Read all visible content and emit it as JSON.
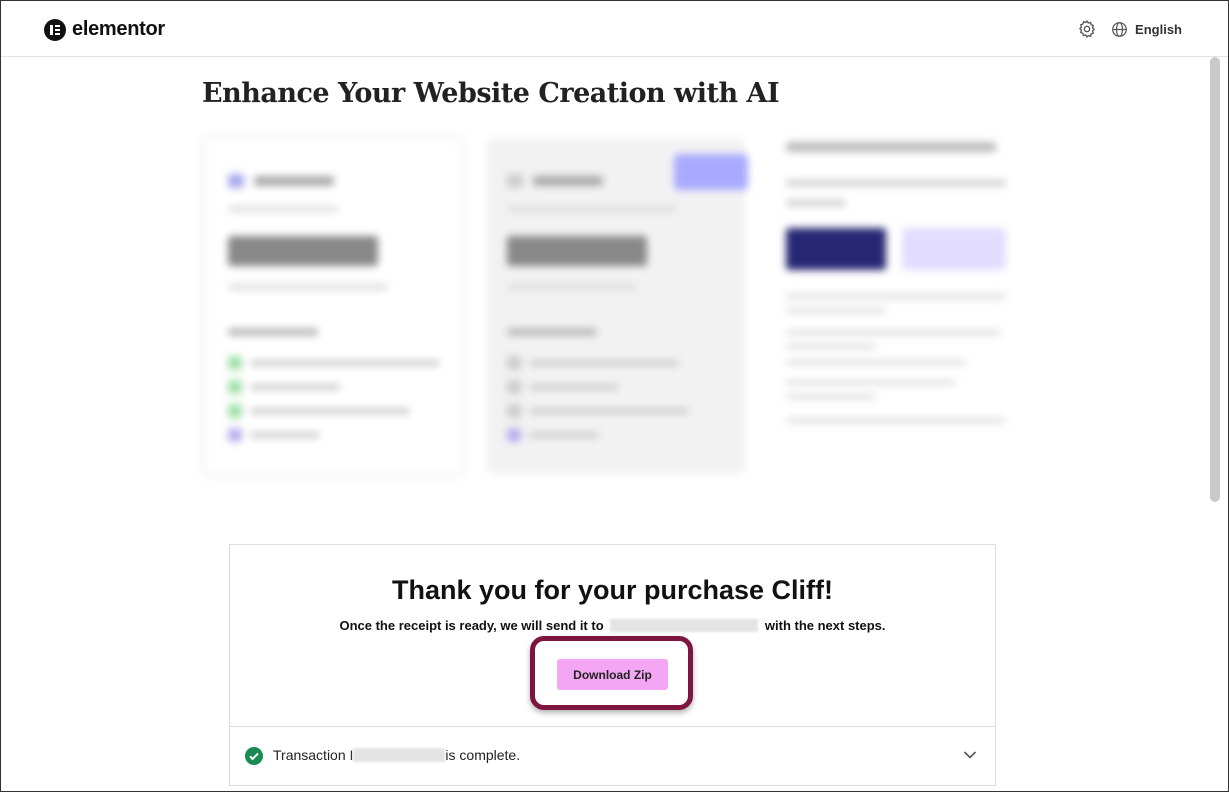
{
  "header": {
    "brand": "elementor",
    "language": "English",
    "icons": [
      "elementor-logo-icon",
      "gear-icon",
      "globe-icon"
    ]
  },
  "main": {
    "title": "Enhance Your Website Creation with AI"
  },
  "purchase": {
    "heading": "Thank you for your purchase Cliff!",
    "receipt_before": "Once the receipt is ready, we will send it to",
    "receipt_after": "with the next steps.",
    "download_label": "Download Zip",
    "transaction_before": "Transaction I",
    "transaction_after": "is complete."
  },
  "colors": {
    "download_button": "#f3a6f3",
    "highlight_outline": "#7d1540",
    "success_check": "#1b8a55"
  }
}
